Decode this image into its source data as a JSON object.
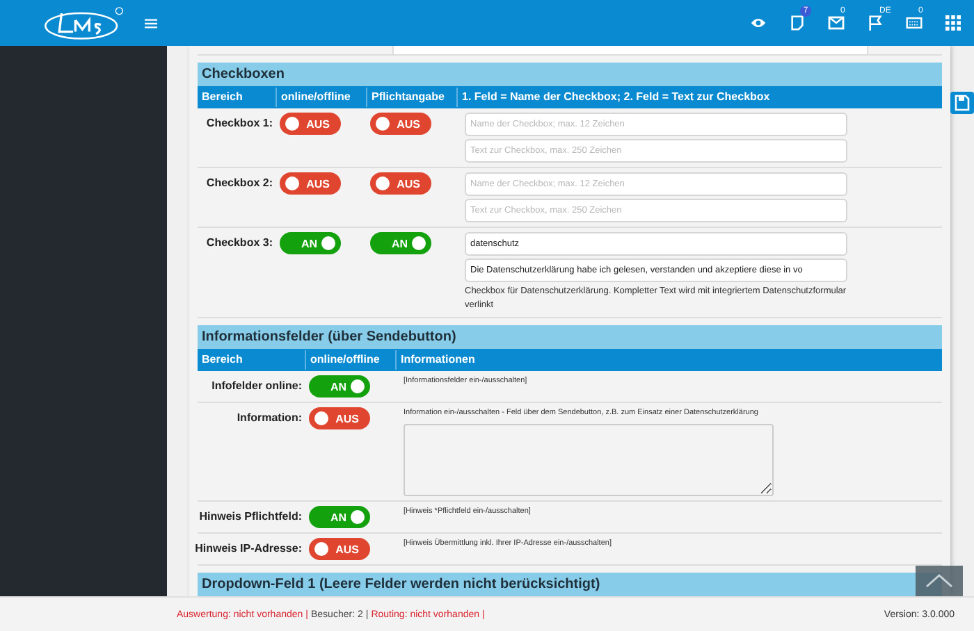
{
  "header": {
    "icons": [
      {
        "kind": "eye"
      },
      {
        "kind": "note",
        "badge": "7"
      },
      {
        "kind": "mail",
        "badge": "0"
      },
      {
        "kind": "flag",
        "badge": "DE"
      },
      {
        "kind": "card",
        "badge": "0"
      },
      {
        "kind": "grid"
      }
    ]
  },
  "checkboxes": {
    "title": "Checkboxen",
    "columns": [
      "Bereich",
      "online/offline",
      "Pflichtangabe",
      "1. Feld = Name der Checkbox; 2. Feld = Text zur Checkbox"
    ],
    "rows": [
      {
        "label": "Checkbox 1:",
        "online": {
          "on": false,
          "text": "AUS"
        },
        "required": {
          "on": false,
          "text": "AUS"
        },
        "name_field": {
          "placeholder": "Name der Checkbox; max. 12 Zeichen"
        },
        "text_field": {
          "placeholder": "Text zur Checkbox, max. 250 Zeichen"
        }
      },
      {
        "label": "Checkbox 2:",
        "online": {
          "on": false,
          "text": "AUS"
        },
        "required": {
          "on": false,
          "text": "AUS"
        },
        "name_field": {
          "placeholder": "Name der Checkbox; max. 12 Zeichen"
        },
        "text_field": {
          "placeholder": "Text zur Checkbox, max. 250 Zeichen"
        }
      },
      {
        "label": "Checkbox 3:",
        "online": {
          "on": true,
          "text": "AN"
        },
        "required": {
          "on": true,
          "text": "AN"
        },
        "name_field": {
          "value": "datenschutz"
        },
        "text_field": {
          "value": "Die Datenschutzerklärung habe ich gelesen, verstanden und akzeptiere diese in vo"
        },
        "note": "Checkbox für Datenschutzerklärung. Kompletter Text wird mit integriertem Datenschutzformular verlinkt"
      }
    ]
  },
  "info": {
    "title": "Informationsfelder (über Sendebutton)",
    "columns": [
      "Bereich",
      "online/offline",
      "Informationen"
    ],
    "rows": [
      {
        "label": "Infofelder online:",
        "toggle": {
          "on": true,
          "text": "AN"
        },
        "info": "[Informationsfelder ein-/ausschalten]"
      },
      {
        "label": "Information:",
        "toggle": {
          "on": false,
          "text": "AUS"
        },
        "info": "Information ein-/ausschalten - Feld über dem Sendebutton, z.B. zum Einsatz einer Datenschutzerklärung",
        "textarea": true
      },
      {
        "label": "Hinweis Pflichtfeld:",
        "toggle": {
          "on": true,
          "text": "AN"
        },
        "info": "[Hinweis *Pflichtfeld ein-/ausschalten]"
      },
      {
        "label": "Hinweis IP-Adresse:",
        "toggle": {
          "on": false,
          "text": "AUS"
        },
        "info": "[Hinweis Übermittlung inkl. Ihrer IP-Adresse ein-/ausschalten]"
      }
    ]
  },
  "dropdown": {
    "title": "Dropdown-Feld 1 (Leere Felder werden nicht berücksichtigt)"
  },
  "footer": {
    "items": [
      {
        "text": "Auswertung: nicht vorhanden",
        "kind": "alert"
      },
      {
        "text": "|",
        "kind": "alert"
      },
      {
        "text": "Besucher: 2",
        "kind": "plain"
      },
      {
        "text": "|",
        "kind": "plain"
      },
      {
        "text": "Routing: nicht vorhanden",
        "kind": "alert"
      },
      {
        "text": "|",
        "kind": "alert"
      }
    ],
    "version": "Version: 3.0.000"
  }
}
